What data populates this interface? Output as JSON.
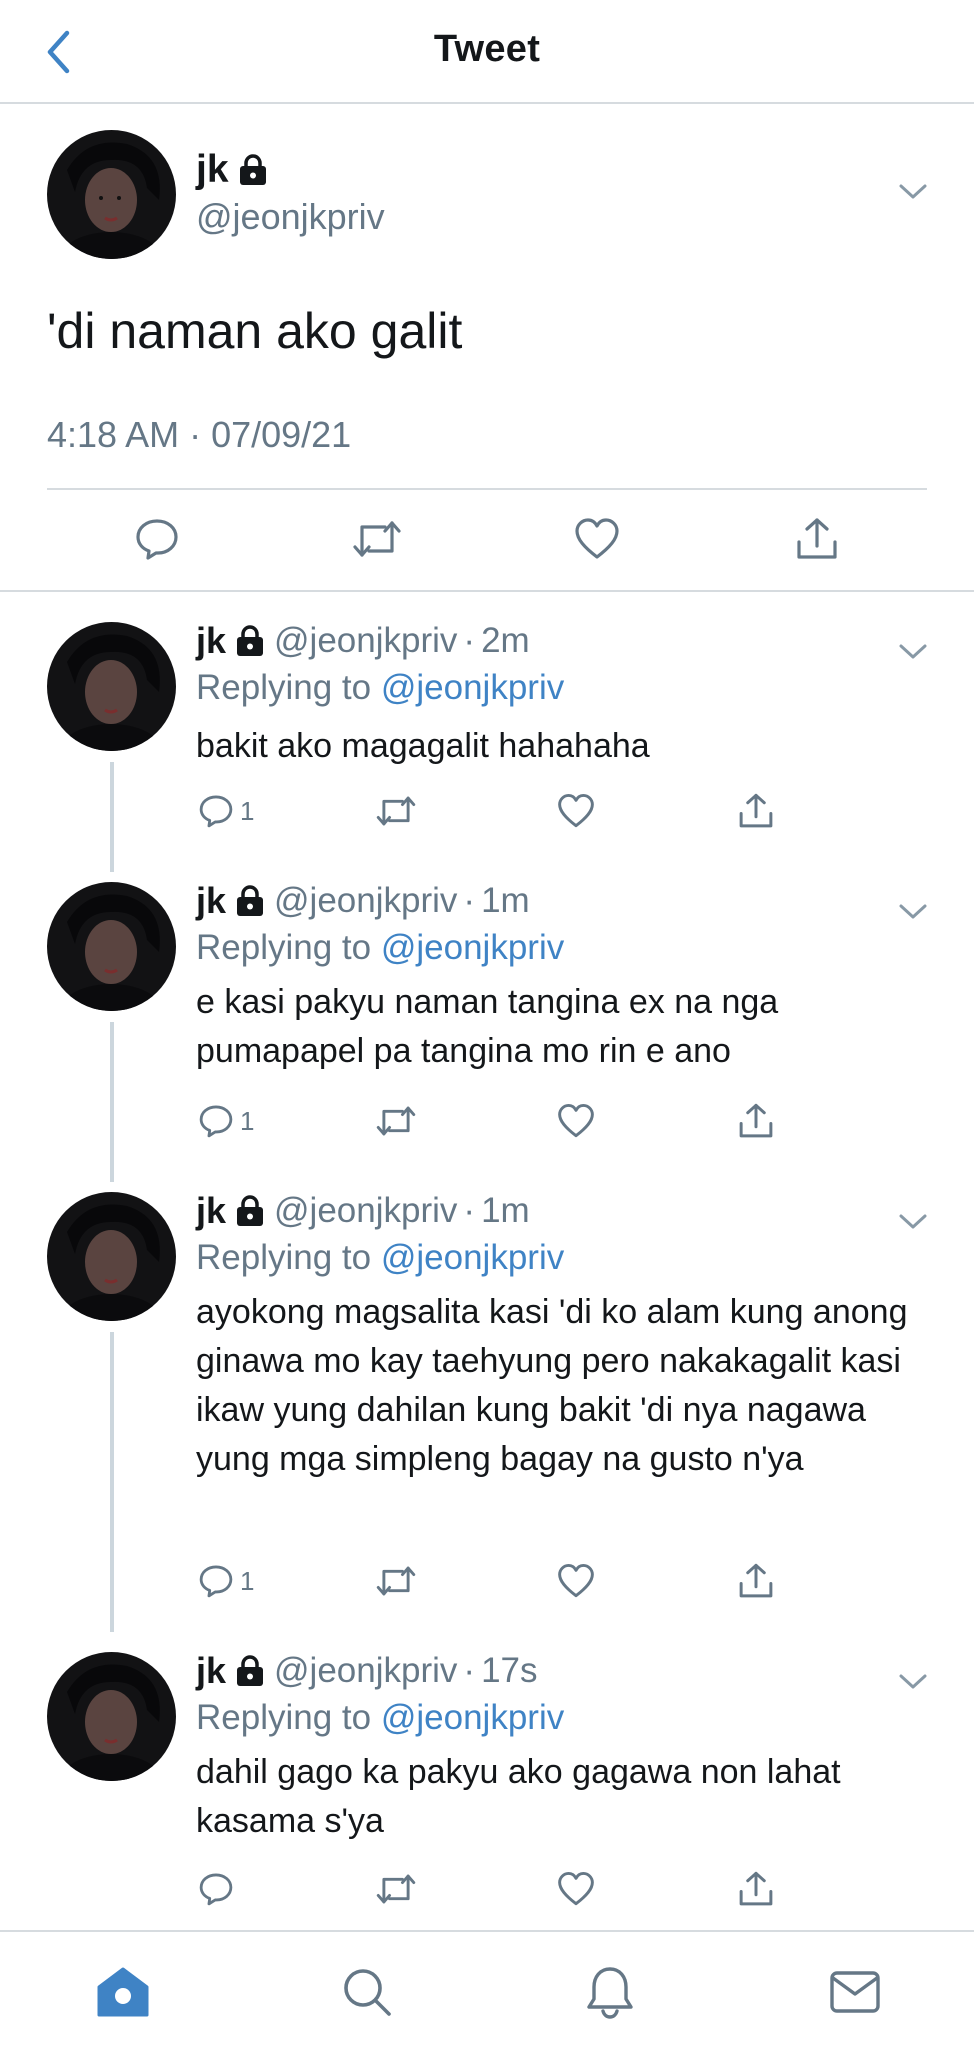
{
  "header": {
    "title": "Tweet",
    "back_icon": "chevron-left-icon",
    "accent": "#3f83c5"
  },
  "main_tweet": {
    "name": "jk",
    "handle": "@jeonjkpriv",
    "text": "'di naman ako galit",
    "timestamp": "4:18 AM · 07/09/21",
    "actions": [
      "reply-icon",
      "retweet-icon",
      "like-icon",
      "share-icon"
    ]
  },
  "replies": [
    {
      "name": "jk",
      "handle": "@jeonjkpriv",
      "dot": "·",
      "time": "2m",
      "replying_prefix": "Replying to",
      "replying_to": "@jeonjkpriv",
      "text": "bakit ako magagalit hahahaha",
      "reply_count": "1"
    },
    {
      "name": "jk",
      "handle": "@jeonjkpriv",
      "dot": "·",
      "time": "1m",
      "replying_prefix": "Replying to",
      "replying_to": "@jeonjkpriv",
      "text": "e kasi pakyu naman tangina ex na nga pumapapel pa tangina mo rin e ano",
      "reply_count": "1"
    },
    {
      "name": "jk",
      "handle": "@jeonjkpriv",
      "dot": "·",
      "time": "1m",
      "replying_prefix": "Replying to",
      "replying_to": "@jeonjkpriv",
      "text": "ayokong magsalita kasi 'di ko alam kung anong ginawa mo kay taehyung pero nakakagalit kasi ikaw yung dahilan kung bakit 'di nya nagawa yung mga simpleng bagay na gusto n'ya",
      "reply_count": "1"
    },
    {
      "name": "jk",
      "handle": "@jeonjkpriv",
      "dot": "·",
      "time": "17s",
      "replying_prefix": "Replying to",
      "replying_to": "@jeonjkpriv",
      "text": "dahil gago ka pakyu ako gagawa non lahat kasama s'ya",
      "reply_count": ""
    }
  ],
  "tabbar": {
    "items": [
      "home-icon",
      "search-icon",
      "notifications-icon",
      "messages-icon"
    ],
    "active": "home-icon"
  }
}
